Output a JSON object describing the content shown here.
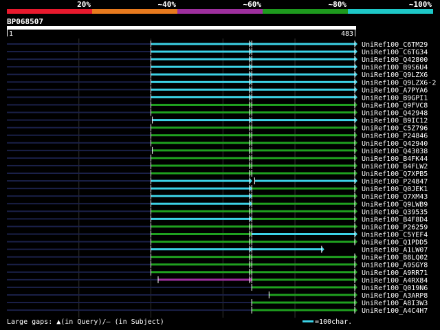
{
  "legend": {
    "labels": [
      "20%",
      "~40%",
      "~60%",
      "~80%",
      "~100%"
    ],
    "colors": [
      "#e8192d",
      "#e87a1e",
      "#9e2f9e",
      "#1e9a1e",
      "#1ec8c8"
    ]
  },
  "query": {
    "id": "BP068507",
    "start": "1",
    "end": "483",
    "length": 483
  },
  "hits": [
    {
      "name": "UniRef100_C6TM29",
      "color": "cyan",
      "segs": [
        [
          0,
          200,
          "navy"
        ],
        [
          200,
          337,
          "cyan"
        ],
        [
          340,
          483,
          "cyan"
        ]
      ]
    },
    {
      "name": "UniRef100_C6TG34",
      "color": "cyan",
      "segs": [
        [
          0,
          200,
          "navy"
        ],
        [
          200,
          337,
          "cyan"
        ],
        [
          340,
          483,
          "cyan"
        ]
      ]
    },
    {
      "name": "UniRef100_Q42800",
      "color": "cyan",
      "segs": [
        [
          0,
          200,
          "navy"
        ],
        [
          200,
          337,
          "cyan"
        ],
        [
          340,
          483,
          "cyan"
        ]
      ]
    },
    {
      "name": "UniRef100_B9S6U4",
      "color": "cyan",
      "segs": [
        [
          0,
          200,
          "navy"
        ],
        [
          200,
          337,
          "cyan"
        ],
        [
          340,
          483,
          "cyan"
        ]
      ]
    },
    {
      "name": "UniRef100_Q9LZX6",
      "color": "cyan",
      "segs": [
        [
          0,
          200,
          "navy"
        ],
        [
          200,
          337,
          "cyan"
        ],
        [
          340,
          483,
          "cyan"
        ]
      ]
    },
    {
      "name": "UniRef100_Q9LZX6-2",
      "color": "cyan",
      "segs": [
        [
          0,
          200,
          "navy"
        ],
        [
          200,
          337,
          "cyan"
        ],
        [
          340,
          483,
          "cyan"
        ]
      ]
    },
    {
      "name": "UniRef100_A7PYA6",
      "color": "cyan",
      "segs": [
        [
          0,
          200,
          "navy"
        ],
        [
          200,
          337,
          "cyan"
        ],
        [
          340,
          483,
          "cyan"
        ]
      ]
    },
    {
      "name": "UniRef100_B9GPI1",
      "color": "cyan",
      "segs": [
        [
          0,
          200,
          "navy"
        ],
        [
          200,
          337,
          "cyan"
        ],
        [
          340,
          483,
          "cyan"
        ]
      ]
    },
    {
      "name": "UniRef100_Q9FVC8",
      "color": "green",
      "segs": [
        [
          0,
          200,
          "navy"
        ],
        [
          200,
          337,
          "green"
        ],
        [
          340,
          483,
          "green"
        ]
      ]
    },
    {
      "name": "UniRef100_Q42948",
      "color": "green",
      "segs": [
        [
          0,
          200,
          "navy"
        ],
        [
          200,
          337,
          "green"
        ],
        [
          340,
          483,
          "green"
        ]
      ]
    },
    {
      "name": "UniRef100_B9IC12",
      "color": "cyan",
      "segs": [
        [
          0,
          202,
          "navy"
        ],
        [
          202,
          337,
          "cyan"
        ],
        [
          340,
          483,
          "cyan"
        ]
      ]
    },
    {
      "name": "UniRef100_C5Z796",
      "color": "green",
      "segs": [
        [
          0,
          200,
          "navy"
        ],
        [
          200,
          337,
          "green"
        ],
        [
          340,
          483,
          "green"
        ]
      ]
    },
    {
      "name": "UniRef100_P24846",
      "color": "green",
      "segs": [
        [
          0,
          200,
          "navy"
        ],
        [
          200,
          337,
          "green"
        ],
        [
          340,
          483,
          "green"
        ]
      ]
    },
    {
      "name": "UniRef100_Q42940",
      "color": "green",
      "segs": [
        [
          0,
          200,
          "navy"
        ],
        [
          200,
          337,
          "green"
        ],
        [
          340,
          483,
          "green"
        ]
      ]
    },
    {
      "name": "UniRef100_Q43038",
      "color": "green",
      "segs": [
        [
          0,
          202,
          "navy"
        ],
        [
          202,
          337,
          "green"
        ],
        [
          340,
          483,
          "green"
        ]
      ]
    },
    {
      "name": "UniRef100_B4FK44",
      "color": "green",
      "segs": [
        [
          0,
          200,
          "navy"
        ],
        [
          200,
          337,
          "green"
        ],
        [
          340,
          483,
          "green"
        ]
      ]
    },
    {
      "name": "UniRef100_B4FLW2",
      "color": "green",
      "segs": [
        [
          0,
          200,
          "navy"
        ],
        [
          200,
          337,
          "green"
        ],
        [
          340,
          483,
          "green"
        ]
      ]
    },
    {
      "name": "UniRef100_Q7XPB5",
      "color": "green",
      "segs": [
        [
          0,
          200,
          "navy"
        ],
        [
          200,
          337,
          "green"
        ],
        [
          340,
          483,
          "green"
        ]
      ]
    },
    {
      "name": "UniRef100_P24847",
      "color": "cyan",
      "segs": [
        [
          0,
          200,
          "navy"
        ],
        [
          200,
          337,
          "cyan"
        ],
        [
          344,
          483,
          "cyan"
        ]
      ]
    },
    {
      "name": "UniRef100_Q0JEK1",
      "color": "cyan",
      "segs": [
        [
          0,
          200,
          "navy"
        ],
        [
          200,
          337,
          "cyan"
        ],
        [
          340,
          483,
          "green"
        ]
      ]
    },
    {
      "name": "UniRef100_Q7XM43",
      "color": "cyan",
      "segs": [
        [
          0,
          200,
          "navy"
        ],
        [
          200,
          337,
          "cyan"
        ],
        [
          340,
          483,
          "green"
        ]
      ]
    },
    {
      "name": "UniRef100_Q9LWB9",
      "color": "cyan",
      "segs": [
        [
          0,
          200,
          "navy"
        ],
        [
          200,
          337,
          "cyan"
        ],
        [
          340,
          483,
          "green"
        ]
      ]
    },
    {
      "name": "UniRef100_Q39535",
      "color": "green",
      "segs": [
        [
          0,
          200,
          "navy"
        ],
        [
          200,
          337,
          "green"
        ],
        [
          340,
          483,
          "green"
        ]
      ]
    },
    {
      "name": "UniRef100_B4F8D4",
      "color": "cyan",
      "segs": [
        [
          0,
          200,
          "navy"
        ],
        [
          200,
          337,
          "cyan"
        ],
        [
          340,
          483,
          "green"
        ]
      ]
    },
    {
      "name": "UniRef100_P26259",
      "color": "green",
      "segs": [
        [
          0,
          200,
          "navy"
        ],
        [
          200,
          337,
          "green"
        ],
        [
          340,
          483,
          "green"
        ]
      ]
    },
    {
      "name": "UniRef100_C5YEF4",
      "color": "green",
      "segs": [
        [
          0,
          200,
          "navy"
        ],
        [
          200,
          337,
          "green"
        ],
        [
          340,
          483,
          "cyan"
        ]
      ]
    },
    {
      "name": "UniRef100_Q1PDD5",
      "color": "green",
      "segs": [
        [
          0,
          200,
          "navy"
        ],
        [
          200,
          337,
          "green"
        ],
        [
          340,
          483,
          "green"
        ]
      ]
    },
    {
      "name": "UniRef100_A1LW07",
      "color": "cyan",
      "segs": [
        [
          0,
          200,
          "navy"
        ],
        [
          200,
          337,
          "cyan"
        ],
        [
          340,
          437,
          "cyan"
        ]
      ]
    },
    {
      "name": "UniRef100_B8LQ02",
      "color": "green",
      "segs": [
        [
          0,
          200,
          "navy"
        ],
        [
          200,
          337,
          "green"
        ],
        [
          340,
          483,
          "green"
        ]
      ]
    },
    {
      "name": "UniRef100_A9SGY8",
      "color": "green",
      "segs": [
        [
          0,
          200,
          "navy"
        ],
        [
          200,
          337,
          "green"
        ],
        [
          340,
          483,
          "green"
        ]
      ]
    },
    {
      "name": "UniRef100_A9RR71",
      "color": "green",
      "segs": [
        [
          0,
          200,
          "navy"
        ],
        [
          200,
          337,
          "green"
        ],
        [
          340,
          483,
          "green"
        ]
      ]
    },
    {
      "name": "UniRef100_A4RX84",
      "color": "purple",
      "segs": [
        [
          0,
          210,
          "navy"
        ],
        [
          210,
          337,
          "purple"
        ],
        [
          340,
          483,
          "green"
        ]
      ]
    },
    {
      "name": "UniRef100_Q019N6",
      "color": "green",
      "segs": [
        [
          0,
          340,
          "navy"
        ],
        [
          340,
          483,
          "green"
        ]
      ]
    },
    {
      "name": "UniRef100_A3ARP8",
      "color": "green",
      "segs": [
        [
          0,
          364,
          "navy"
        ],
        [
          364,
          483,
          "green"
        ]
      ]
    },
    {
      "name": "UniRef100_A8I3W3",
      "color": "green",
      "segs": [
        [
          0,
          340,
          "navy"
        ],
        [
          340,
          483,
          "green"
        ]
      ]
    },
    {
      "name": "UniRef100_A4C4H7",
      "color": "green",
      "segs": [
        [
          0,
          340,
          "navy"
        ],
        [
          340,
          483,
          "green"
        ]
      ]
    }
  ],
  "footer": {
    "gaps_label": "Large gaps: ▲(in Query)/– (in Subject)",
    "scale_label": "=100char."
  },
  "palette": {
    "cyan": "#3cd2e6",
    "green": "#1fa01f",
    "purple": "#9e2f9e",
    "navy": "#1a2048",
    "grid": "#333333"
  }
}
